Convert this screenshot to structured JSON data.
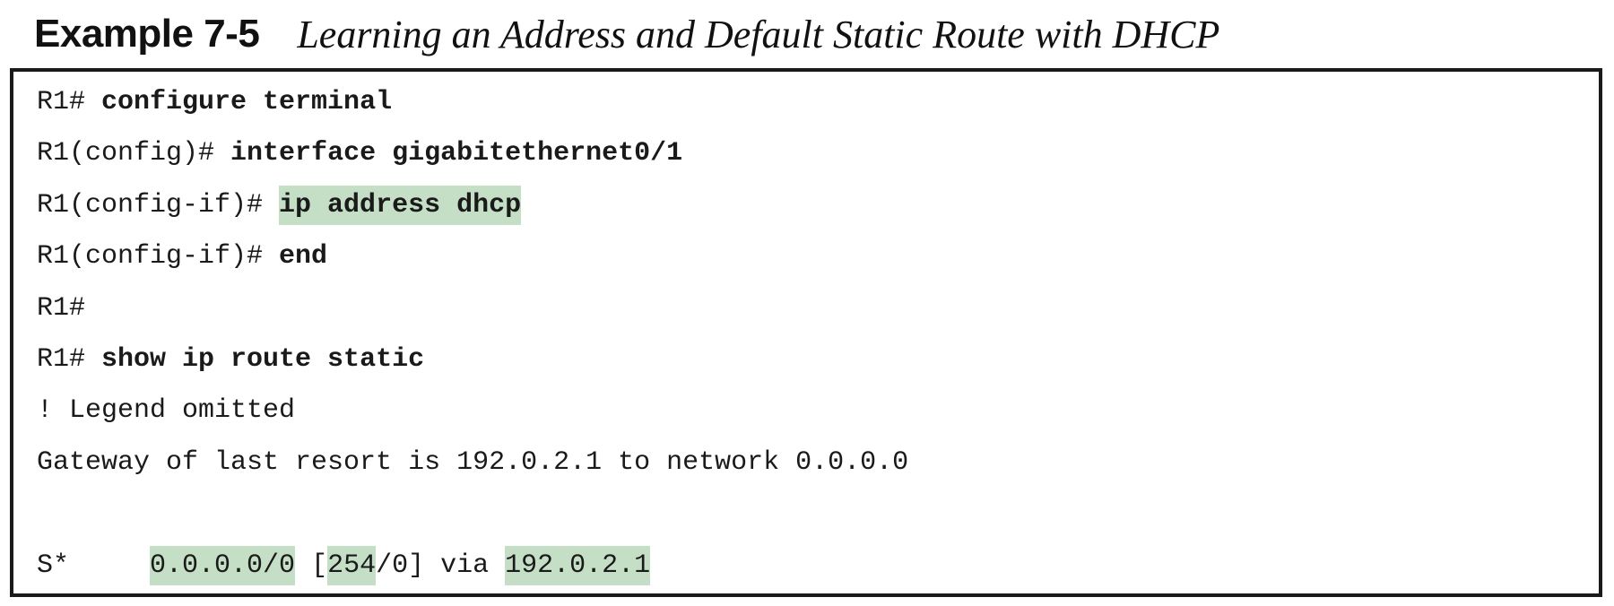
{
  "example": {
    "number": "Example 7-5",
    "title": "Learning an Address and Default Static Route with DHCP"
  },
  "lines": [
    {
      "segments": [
        {
          "text": "R1# ",
          "style": "normal"
        },
        {
          "text": "configure terminal",
          "style": "bold"
        }
      ]
    },
    {
      "segments": [
        {
          "text": "R1(config)# ",
          "style": "normal"
        },
        {
          "text": "interface gigabitethernet0/1",
          "style": "bold"
        }
      ]
    },
    {
      "segments": [
        {
          "text": "R1(config-if)# ",
          "style": "normal"
        },
        {
          "text": "ip address dhcp",
          "style": "bold-highlight"
        }
      ]
    },
    {
      "segments": [
        {
          "text": "R1(config-if)# ",
          "style": "normal"
        },
        {
          "text": "end",
          "style": "bold"
        }
      ]
    },
    {
      "segments": [
        {
          "text": "R1#",
          "style": "normal"
        }
      ]
    },
    {
      "segments": [
        {
          "text": "R1# ",
          "style": "normal"
        },
        {
          "text": "show ip route static",
          "style": "bold"
        }
      ]
    },
    {
      "segments": [
        {
          "text": "! Legend omitted",
          "style": "normal"
        }
      ]
    },
    {
      "segments": [
        {
          "text": "Gateway of last resort is 192.0.2.1 to network 0.0.0.0",
          "style": "normal"
        }
      ]
    },
    {
      "segments": []
    },
    {
      "segments": [
        {
          "text": "S*     ",
          "style": "normal"
        },
        {
          "text": "0.0.0.0/0",
          "style": "highlight"
        },
        {
          "text": " [",
          "style": "normal"
        },
        {
          "text": "254",
          "style": "highlight"
        },
        {
          "text": "/0] via ",
          "style": "normal"
        },
        {
          "text": "192.0.2.1",
          "style": "highlight"
        }
      ]
    }
  ],
  "colors": {
    "highlight": "#c5dfc6",
    "border": "#1a1a1a",
    "text": "#1a1a1a"
  }
}
